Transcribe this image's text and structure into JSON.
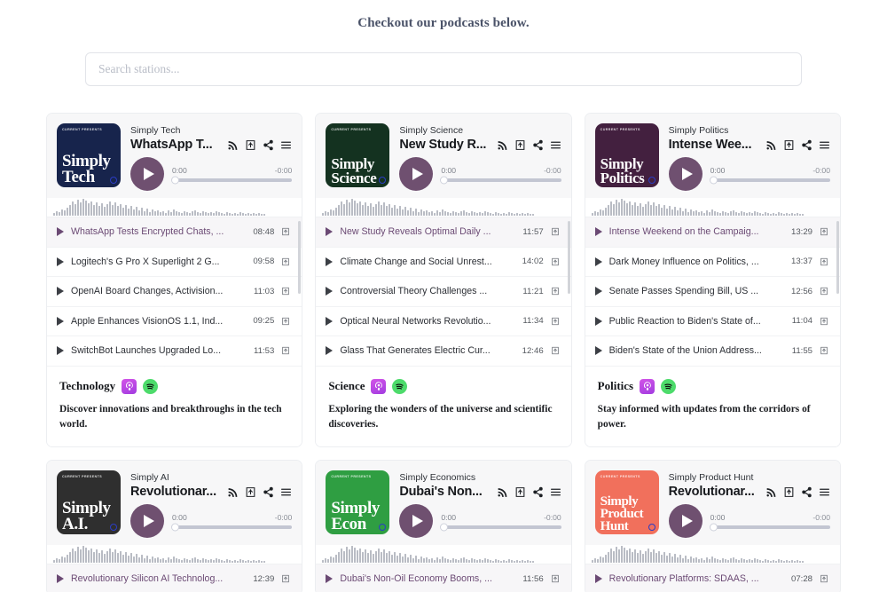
{
  "header": {
    "title": "Checkout our podcasts below."
  },
  "search": {
    "placeholder": "Search stations...",
    "value": ""
  },
  "player_icons": {
    "rss": "rss-icon",
    "download": "download-icon",
    "share": "share-icon",
    "playlist": "playlist-icon"
  },
  "colors": {
    "accent_purple": "#6f5070",
    "heading": "#4a5268",
    "spotify_green": "#4ddb6b",
    "apple_purple": "#b845e4"
  },
  "cover_kicker": "CURRENT PRESENTS",
  "cards": [
    {
      "show_name": "Simply Tech",
      "episode_title": "WhatsApp T...",
      "cover_title": "Simply\nTech",
      "cover_bg": "#17244c",
      "cover_font_size": "19px",
      "time_current": "0:00",
      "time_remaining": "-0:00",
      "category": "Technology",
      "description": "Discover innovations and breakthroughs in the tech world.",
      "episodes": [
        {
          "name": "WhatsApp Tests Encrypted Chats, ...",
          "duration": "08:48",
          "active": true
        },
        {
          "name": "Logitech's G Pro X Superlight 2 G...",
          "duration": "09:58",
          "active": false
        },
        {
          "name": "OpenAI Board Changes, Activision...",
          "duration": "11:03",
          "active": false
        },
        {
          "name": "Apple Enhances VisionOS 1.1, Ind...",
          "duration": "09:25",
          "active": false
        },
        {
          "name": "SwitchBot Launches Upgraded Lo...",
          "duration": "11:53",
          "active": false
        }
      ]
    },
    {
      "show_name": "Simply Science",
      "episode_title": "New Study R...",
      "cover_title": "Simply\nScience",
      "cover_bg": "#143220",
      "cover_font_size": "17px",
      "time_current": "0:00",
      "time_remaining": "-0:00",
      "category": "Science",
      "description": "Exploring the wonders of the universe and scientific discoveries.",
      "episodes": [
        {
          "name": "New Study Reveals Optimal Daily ...",
          "duration": "11:57",
          "active": true
        },
        {
          "name": "Climate Change and Social Unrest...",
          "duration": "14:02",
          "active": false
        },
        {
          "name": "Controversial Theory Challenges ...",
          "duration": "11:21",
          "active": false
        },
        {
          "name": "Optical Neural Networks Revolutio...",
          "duration": "11:34",
          "active": false
        },
        {
          "name": "Glass That Generates Electric Cur...",
          "duration": "12:46",
          "active": false
        }
      ]
    },
    {
      "show_name": "Simply Politics",
      "episode_title": "Intense Wee...",
      "cover_title": "Simply\nPolitics",
      "cover_bg": "#43203f",
      "cover_font_size": "17px",
      "time_current": "0:00",
      "time_remaining": "-0:00",
      "category": "Politics",
      "description": "Stay informed with updates from the corridors of power.",
      "episodes": [
        {
          "name": "Intense Weekend on the Campaig...",
          "duration": "13:29",
          "active": true
        },
        {
          "name": "Dark Money Influence on Politics, ...",
          "duration": "13:37",
          "active": false
        },
        {
          "name": "Senate Passes Spending Bill, US ...",
          "duration": "12:56",
          "active": false
        },
        {
          "name": "Public Reaction to Biden's State of...",
          "duration": "11:04",
          "active": false
        },
        {
          "name": "Biden's State of the Union Address...",
          "duration": "11:55",
          "active": false
        }
      ]
    },
    {
      "show_name": "Simply AI",
      "episode_title": "Revolutionar...",
      "cover_title": "Simply\nA.I.",
      "cover_bg": "#2f2f2f",
      "cover_font_size": "19px",
      "time_current": "0:00",
      "time_remaining": "-0:00",
      "category": "",
      "description": "",
      "episodes": [
        {
          "name": "Revolutionary Silicon AI Technolog...",
          "duration": "12:39",
          "active": true
        }
      ]
    },
    {
      "show_name": "Simply Economics",
      "episode_title": "Dubai's Non...",
      "cover_title": "Simply\nEcon",
      "cover_bg": "#2f9e42",
      "cover_font_size": "19px",
      "time_current": "0:00",
      "time_remaining": "-0:00",
      "category": "",
      "description": "",
      "episodes": [
        {
          "name": "Dubai's Non-Oil Economy Booms, ...",
          "duration": "11:56",
          "active": true
        }
      ]
    },
    {
      "show_name": "Simply Product Hunt",
      "episode_title": "Revolutionar...",
      "cover_title": "Simply\nProduct\nHunt",
      "cover_bg": "#f1705c",
      "cover_font_size": "15px",
      "time_current": "0:00",
      "time_remaining": "-0:00",
      "category": "",
      "description": "",
      "episodes": [
        {
          "name": "Revolutionary Platforms: SDAAS, ...",
          "duration": "07:28",
          "active": true
        }
      ]
    }
  ]
}
